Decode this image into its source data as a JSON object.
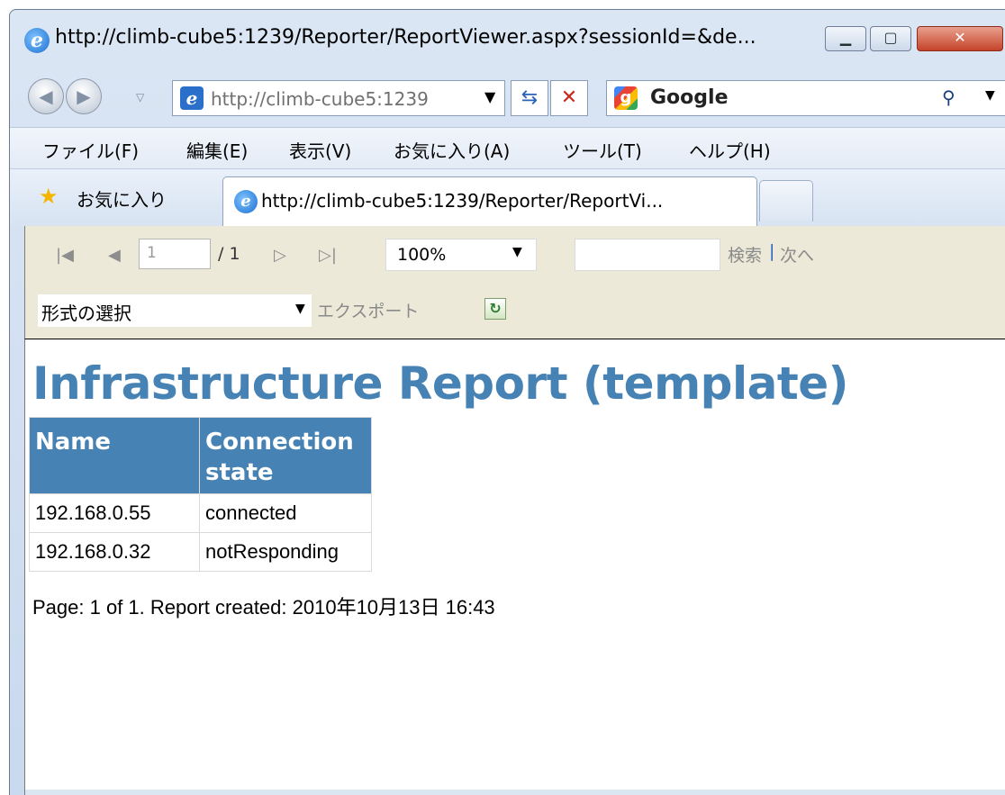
{
  "window": {
    "title": "http://climb-cube5:1239/Reporter/ReportViewer.aspx?sessionId=&de...",
    "min_icon": "minimize-icon",
    "max_icon": "maximize-icon",
    "close_icon": "close-icon"
  },
  "nav": {
    "address": "http://climb-cube5:1239",
    "search_provider": "Google"
  },
  "menu": [
    "ファイル(F)",
    "編集(E)",
    "表示(V)",
    "お気に入り(A)",
    "ツール(T)",
    "ヘルプ(H)"
  ],
  "favorites": {
    "label": "お気に入り"
  },
  "tab": {
    "title": "http://climb-cube5:1239/Reporter/ReportVi..."
  },
  "viewer": {
    "page_current": "1",
    "page_total": "/ 1",
    "zoom": "100%",
    "find_label": "検索",
    "find_separator": "|",
    "next_label": "次へ",
    "format_select": "形式の選択",
    "export_label": "エクスポート"
  },
  "report": {
    "title": "Infrastructure Report (template)",
    "columns": [
      "Name",
      "Connection state"
    ],
    "rows": [
      [
        "192.168.0.55",
        "connected"
      ],
      [
        "192.168.0.32",
        "notResponding"
      ]
    ],
    "footer": "Page: 1 of 1. Report created: 2010年10月13日 16:43"
  },
  "colors": {
    "report_accent": "#4682b4",
    "toolbar_bg": "#ece9d8"
  }
}
